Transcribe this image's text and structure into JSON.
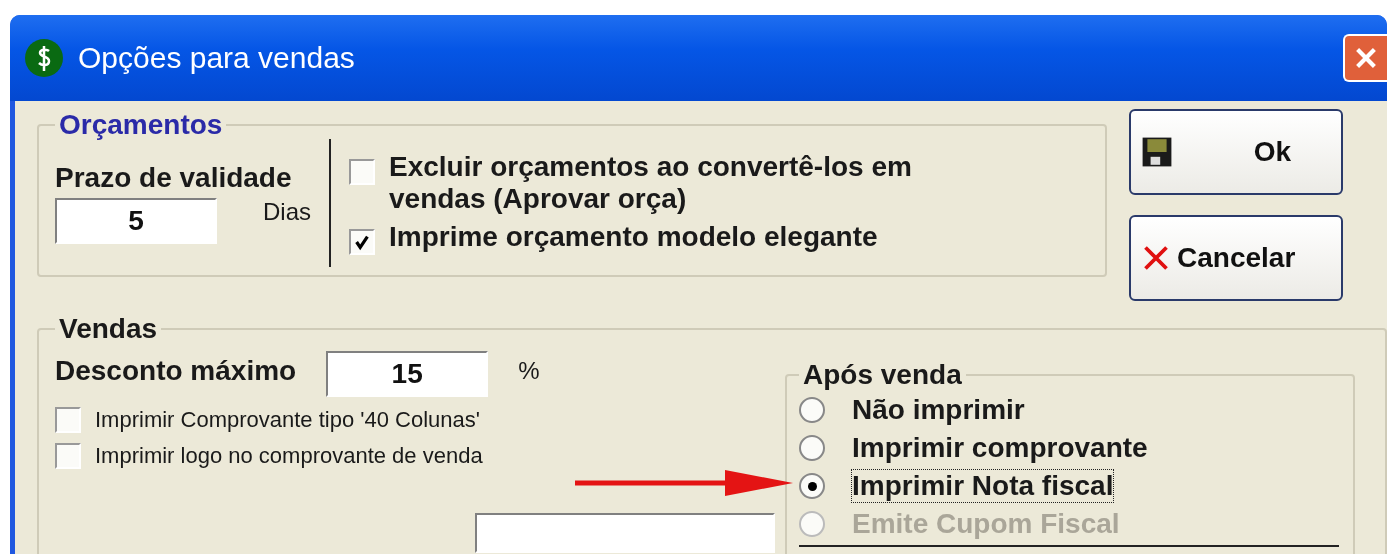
{
  "window": {
    "title": "Opções para vendas"
  },
  "orcamentos": {
    "title": "Orçamentos",
    "validity_label": "Prazo de validade",
    "validity_value": "5",
    "validity_unit": "Dias",
    "options": [
      {
        "label": "Excluir orçamentos ao convertê-los em vendas (Aprovar orça)",
        "checked": false
      },
      {
        "label": "Imprime orçamento modelo elegante",
        "checked": true
      }
    ]
  },
  "buttons": [
    {
      "label": "Ok",
      "kind": "save"
    },
    {
      "label": "Cancelar",
      "kind": "cancel"
    }
  ],
  "vendas": {
    "title": "Vendas",
    "discount_label": "Desconto máximo",
    "discount_value": "15",
    "discount_unit": "%",
    "options": [
      {
        "label": "Imprimir Comprovante tipo '40 Colunas'",
        "checked": false
      },
      {
        "label": "Imprimir logo no comprovante de venda",
        "checked": false
      }
    ],
    "after_sale": {
      "title": "Após venda",
      "options": [
        {
          "label": "Não imprimir",
          "selected": false,
          "disabled": false
        },
        {
          "label": "Imprimir comprovante",
          "selected": false,
          "disabled": false
        },
        {
          "label": "Imprimir Nota fiscal",
          "selected": true,
          "disabled": false
        },
        {
          "label": "Emite Cupom Fiscal",
          "selected": false,
          "disabled": true
        }
      ]
    }
  }
}
